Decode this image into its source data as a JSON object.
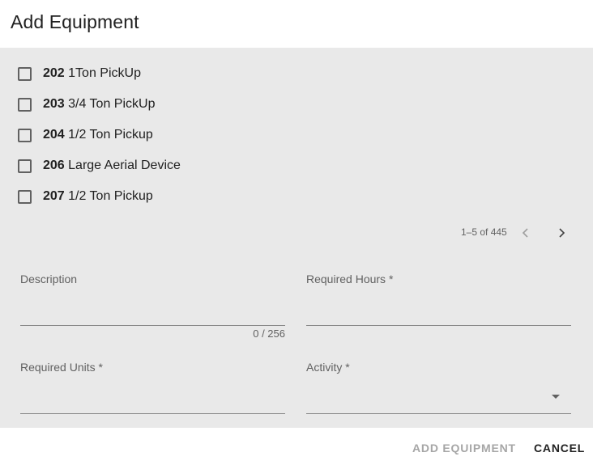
{
  "dialog": {
    "title": "Add Equipment"
  },
  "equipment_list": {
    "items": [
      {
        "code": "202",
        "name": "1Ton PickUp",
        "checked": false
      },
      {
        "code": "203",
        "name": "3/4 Ton PickUp",
        "checked": false
      },
      {
        "code": "204",
        "name": "1/2 Ton Pickup",
        "checked": false
      },
      {
        "code": "206",
        "name": "Large Aerial Device",
        "checked": false
      },
      {
        "code": "207",
        "name": "1/2 Ton Pickup",
        "checked": false
      }
    ]
  },
  "pagination": {
    "range_label": "1–5 of 445",
    "prev_icon": "chevron-left-icon",
    "next_icon": "chevron-right-icon"
  },
  "form": {
    "description": {
      "label": "Description",
      "value": "",
      "counter": "0 / 256"
    },
    "required_hours": {
      "label": "Required Hours *",
      "value": ""
    },
    "required_units": {
      "label": "Required Units *",
      "value": ""
    },
    "activity": {
      "label": "Activity *",
      "value": "",
      "icon": "dropdown-arrow-icon"
    }
  },
  "actions": {
    "add_label": "ADD EQUIPMENT",
    "add_enabled": false,
    "cancel_label": "CANCEL"
  },
  "colors": {
    "content_background": "#e9e9e9",
    "disabled_text": "#a6a6a6",
    "primary_text": "#212121",
    "secondary_text": "#616161"
  }
}
